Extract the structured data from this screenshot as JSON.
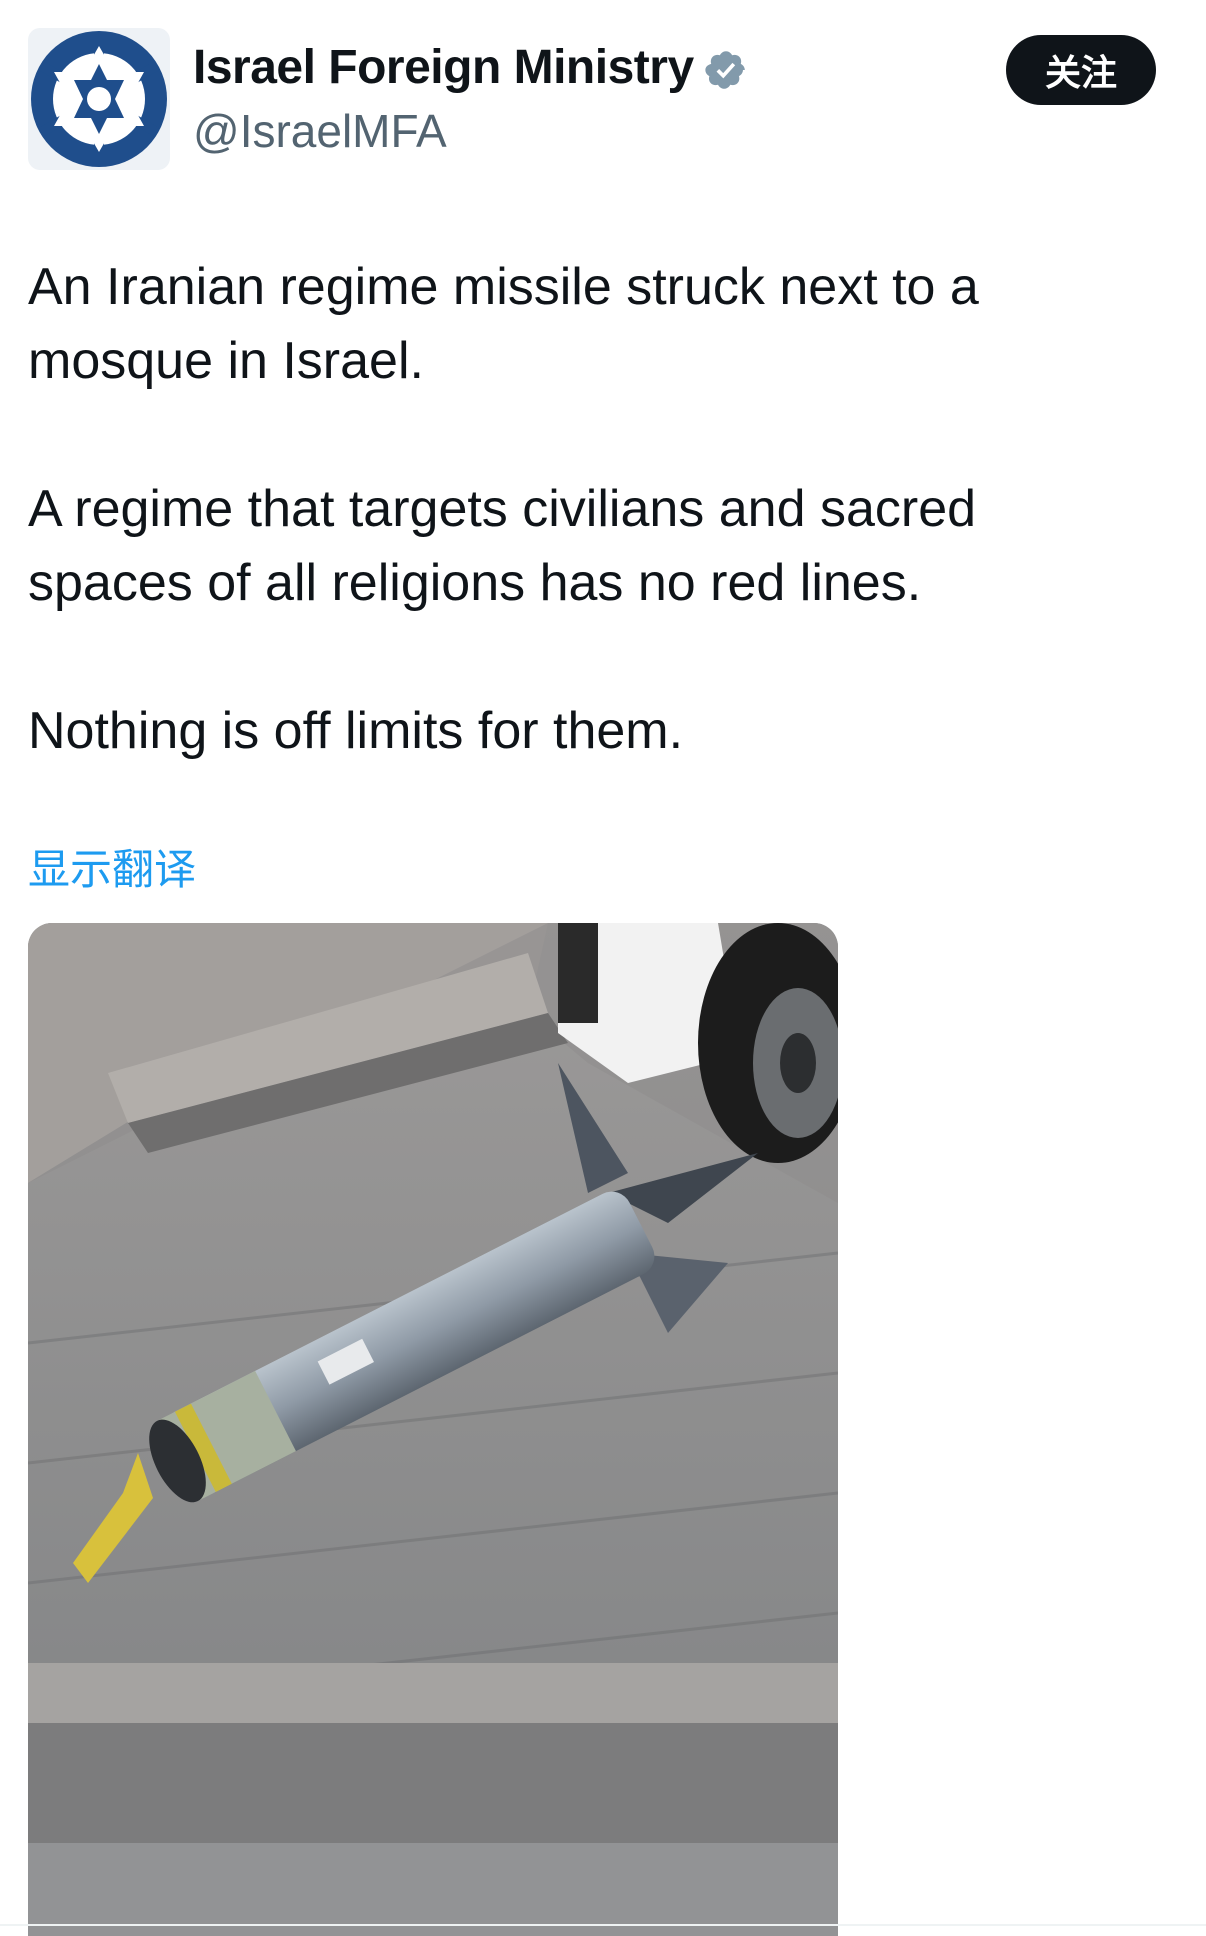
{
  "account": {
    "display_name": "Israel Foreign Ministry",
    "handle": "@IsraelMFA",
    "verified_icon": "verified-badge-icon",
    "avatar_icon": "star-emblem-icon",
    "avatar_colors": {
      "navy": "#1f4e8c",
      "white": "#ffffff"
    }
  },
  "follow_button": {
    "label": "关注"
  },
  "tweet": {
    "paragraphs": [
      "An Iranian regime missile struck next to a mosque in Israel.",
      "A regime that targets civilians and sacred spaces of all religions has no red lines.",
      "Nothing is off limits for them."
    ],
    "translate_label": "显示翻译"
  },
  "media": {
    "icon": "photo-icon"
  },
  "colors": {
    "text": "#0f1419",
    "secondary": "#536471",
    "link": "#1d9bf0",
    "button_bg": "#0f1419",
    "verified_badge": "#829aab"
  }
}
